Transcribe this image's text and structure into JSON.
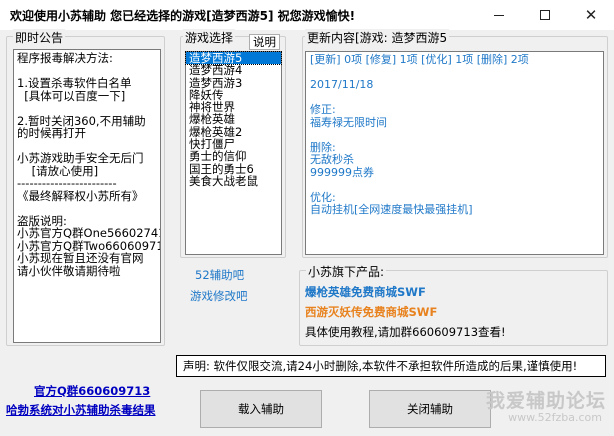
{
  "window": {
    "title": "欢迎使用小苏辅助  您已经选择的游戏[造梦西游5] 祝您游戏愉快!",
    "minimize_glyph": "—",
    "maximize_glyph": "☐",
    "close_glyph": "✕"
  },
  "notice": {
    "legend": "即时公告",
    "text": "程序报毒解决方法:\n\n1.设置杀毒软件白名单\n  [具体可以百度一下]\n\n2.暂时关闭360,不用辅助\n的时候再打开\n\n小苏游戏助手安全无后门\n    [请放心使用]\n------------------------\n《最终解释权小苏所有》\n\n盗版说明:\n小苏官方Q群One566027415\n小苏官方Q群Two660609713\n小苏现在暂且还没有官网\n请小伙伴敬请期待啦"
  },
  "game_select": {
    "legend": "游戏选择",
    "tab_label": "说明",
    "items": [
      "造梦西游5",
      "造梦西游4",
      "造梦西游3",
      "降妖传",
      "神将世界",
      "爆枪英雄",
      "爆枪英雄2",
      "快打僵尸",
      "勇士的信仰",
      "国王的勇士6",
      "美食大战老鼠"
    ],
    "selected_index": 0
  },
  "update": {
    "legend": "更新内容[游戏: 造梦西游5",
    "text": "[更新] 0项 [修复] 1项 [优化] 1项 [删除] 2项\n\n2017/11/18\n\n修正:\n福寿禄无限时间\n\n删除:\n无敌秒杀\n999999点券\n\n优化:\n自动挂机[全网速度最快最强挂机]"
  },
  "links": {
    "bar52": "52辅助吧",
    "modify": "游戏修改吧",
    "qq_group": "官方Q群660609713",
    "antivirus": "哈勃系统对小苏辅助杀毒结果"
  },
  "products": {
    "legend": "小苏旗下产品:",
    "item1": "爆枪英雄免费商城SWF",
    "item2": "西游灭妖传免费商城SWF",
    "tutorial": "具体使用教程,请加群660609713查看!"
  },
  "declaration": "声明: 软件仅限交流,请24小时删除,本软件不承担软件所造成的后果,谨慎使用!",
  "buttons": {
    "load": "载入辅助",
    "close": "关闭辅助"
  },
  "watermark": {
    "line1": "我爱辅助论坛",
    "line2": "www.52fzba.com"
  },
  "colors": {
    "link_blue": "#1f78c8",
    "product1": "#1f78c8",
    "product2": "#e8821e",
    "selection": "#0078d7"
  }
}
